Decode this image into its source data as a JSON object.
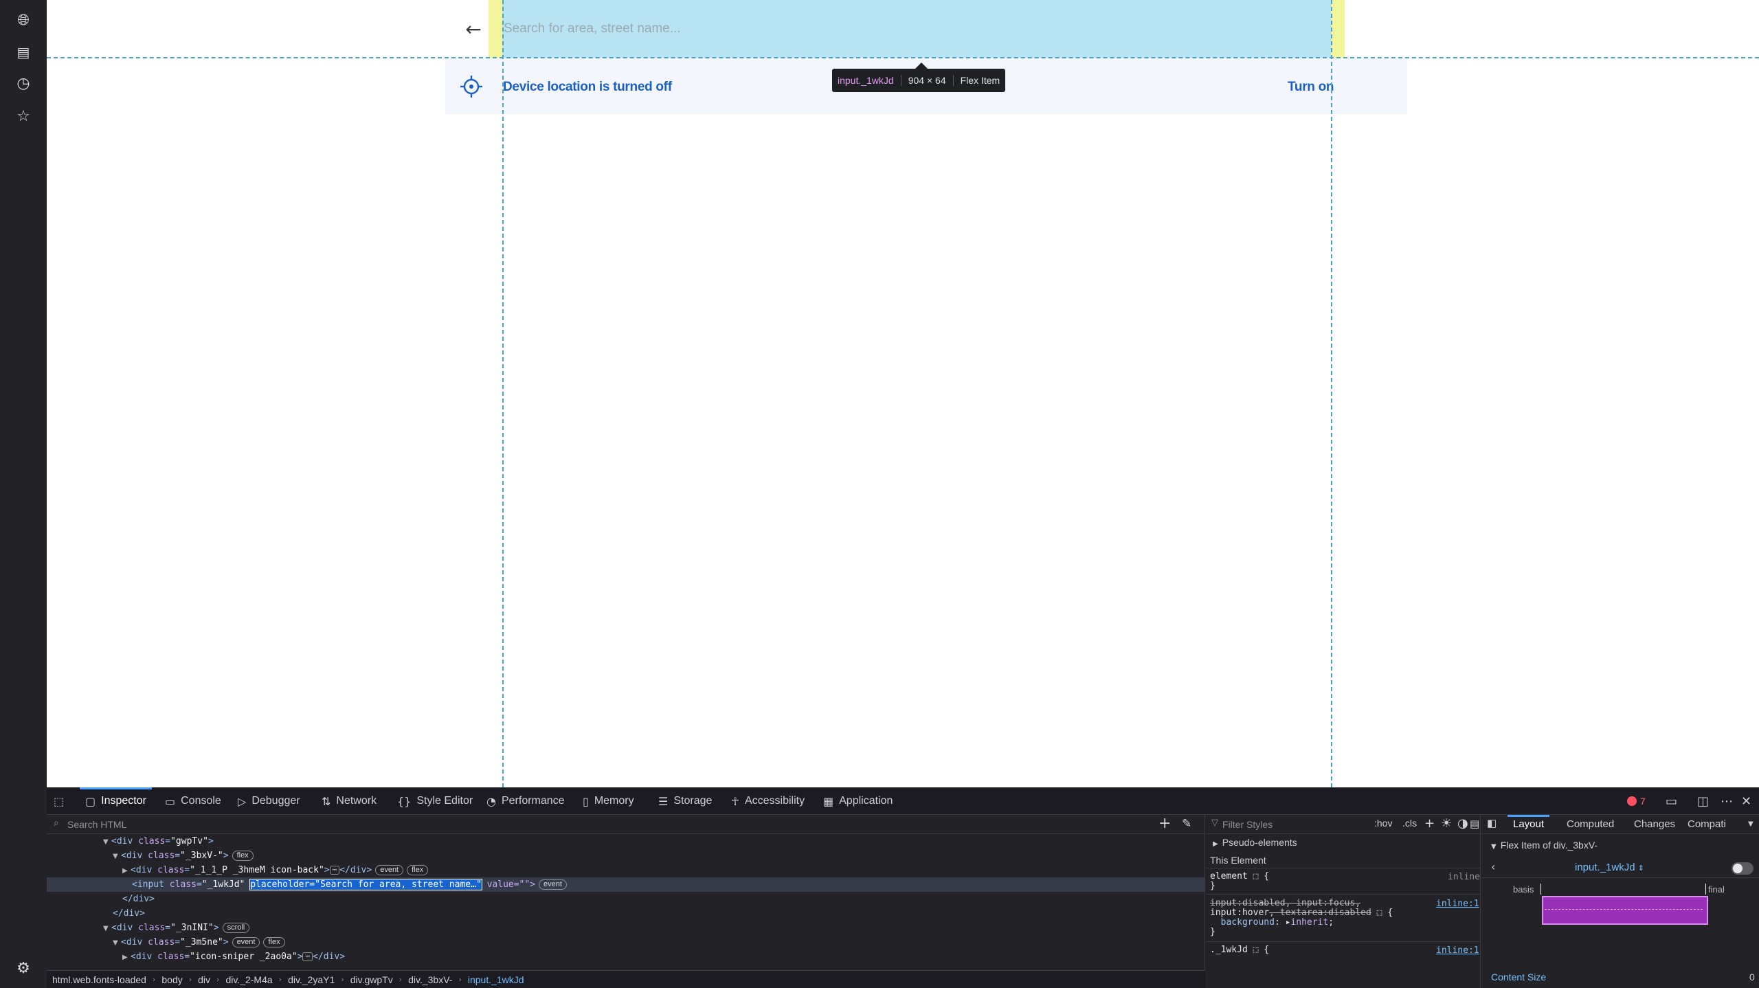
{
  "sidebar": {
    "icons": [
      "globe-icon",
      "media-icon",
      "history-icon",
      "star-icon",
      "settings-icon"
    ]
  },
  "page": {
    "back_arrow": "←",
    "search_placeholder": "Search for area, street name...",
    "search_value": "",
    "location_banner": {
      "message": "Device location is turned off",
      "action": "Turn on"
    }
  },
  "tooltip": {
    "name": "input._1wkJd",
    "size": "904 × 64",
    "type": "Flex Item"
  },
  "devtools": {
    "tabs": [
      {
        "label": "Inspector",
        "icon": "inspector-icon"
      },
      {
        "label": "Console",
        "icon": "console-icon"
      },
      {
        "label": "Debugger",
        "icon": "debugger-icon"
      },
      {
        "label": "Network",
        "icon": "network-icon"
      },
      {
        "label": "Style Editor",
        "icon": "style-editor-icon"
      },
      {
        "label": "Performance",
        "icon": "performance-icon"
      },
      {
        "label": "Memory",
        "icon": "memory-icon"
      },
      {
        "label": "Storage",
        "icon": "storage-icon"
      },
      {
        "label": "Accessibility",
        "icon": "accessibility-icon"
      },
      {
        "label": "Application",
        "icon": "application-icon"
      }
    ],
    "error_count": "7",
    "html_search_placeholder": "Search HTML",
    "nodes": [
      {
        "tag": "<div ",
        "attr": "class",
        "val": "\"gwpTv\"",
        "close": ">",
        "badges": []
      },
      {
        "tag": "<div ",
        "attr": "class",
        "val": "\"_3bxV-\"",
        "close": ">",
        "badges": [
          "flex"
        ]
      },
      {
        "tag": "<div ",
        "attr": "class",
        "val": "\"_1_1_P _3hmeM icon-back\"",
        "close": ">",
        "tail": "</div>",
        "badges": [
          "event",
          "flex"
        ]
      },
      {
        "tag": "<input ",
        "attr": "class",
        "val": "\"_1wkJd\"",
        "hl": "placeholder=\"Search for area, street name…\"",
        "tail": " value=\"\">",
        "badges": [
          "event"
        ]
      },
      {
        "text": "</div>"
      },
      {
        "text": "</div>"
      },
      {
        "tag": "<div ",
        "attr": "class",
        "val": "\"_3nINI\"",
        "close": ">",
        "badges": [
          "scroll"
        ]
      },
      {
        "tag": "<div ",
        "attr": "class",
        "val": "\"_3m5ne\"",
        "close": ">",
        "badges": [
          "event",
          "flex"
        ]
      },
      {
        "tag": "<div ",
        "attr": "class",
        "val": "\"icon-sniper _2ao0a\"",
        "close": ">",
        "tail": "</div>",
        "badges": []
      }
    ],
    "breadcrumbs": [
      "html.web.fonts-loaded",
      "body",
      "div",
      "div._2-M4a",
      "div._2yaY1",
      "div.gwpTv",
      "div._3bxV-",
      "input._1wkJd"
    ],
    "rules": {
      "filter_placeholder": "Filter Styles",
      "hov": ":hov",
      "cls": ".cls",
      "pseudo_elements": "Pseudo-elements",
      "this_element": "This Element",
      "element_selector": "element",
      "element_src": "inline",
      "rule1_selector_line1": "input:disabled, input:focus,",
      "rule1_selector_line2_a": "input:hover",
      "rule1_selector_line2_b": ", textarea:disabled",
      "rule1_prop": "background",
      "rule1_val": "inherit",
      "rule1_src": "inline:1",
      "rule2_selector": "._1wkJd",
      "rule2_src": "inline:1"
    },
    "layout": {
      "tabs": [
        "Layout",
        "Computed",
        "Changes",
        "Compati"
      ],
      "flex_item_of": "Flex Item of div._3bxV-",
      "selected_item": "input._1wkJd",
      "basis_label": "basis",
      "final_label": "final",
      "content_size_label": "Content Size",
      "content_size_value": "0"
    }
  }
}
